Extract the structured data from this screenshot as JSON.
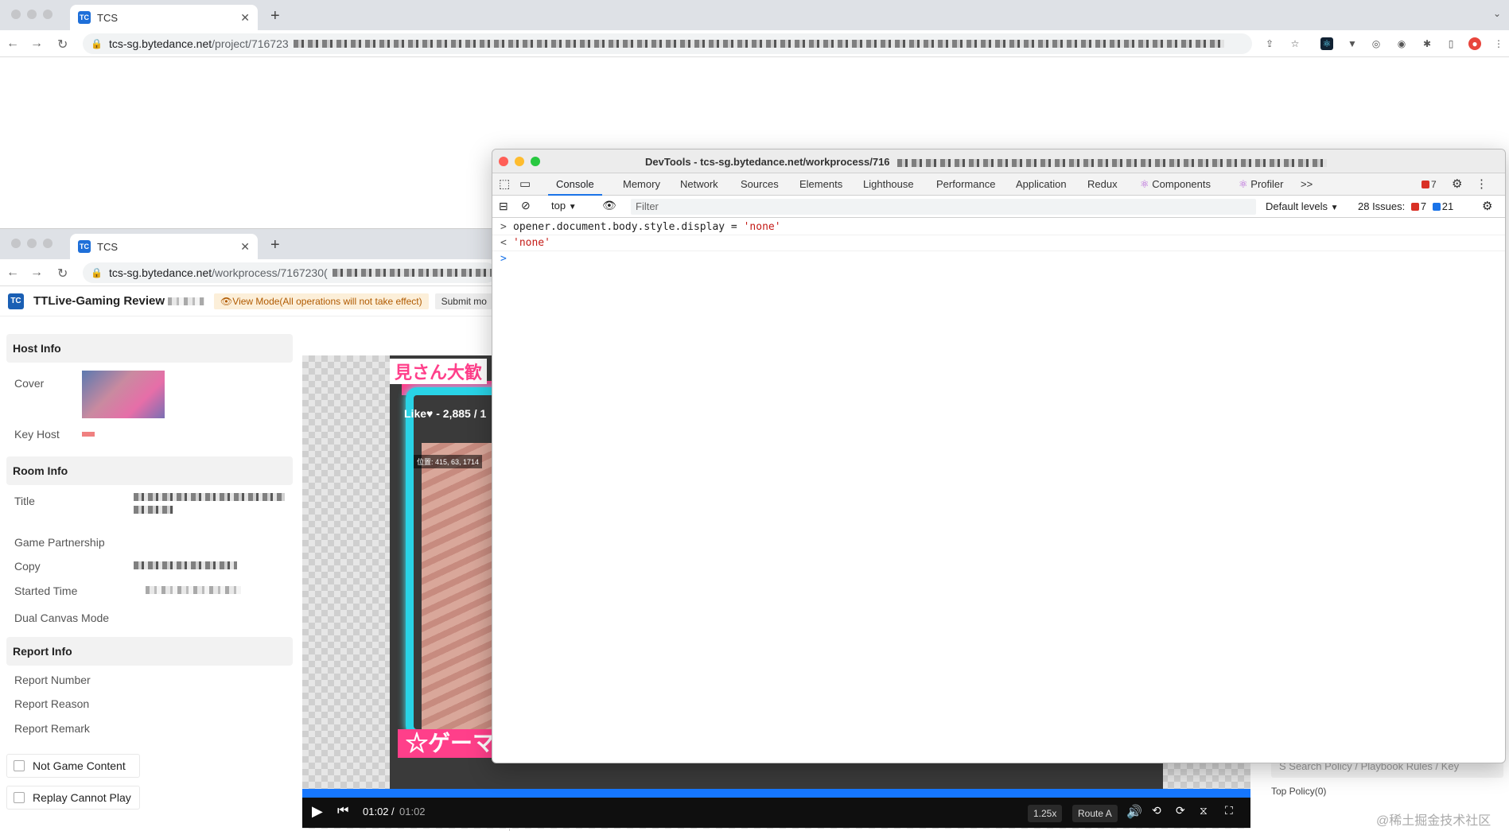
{
  "back_browser": {
    "tab_title": "TCS",
    "new_tab_icon": "+",
    "url_host": "tcs-sg.bytedance.net",
    "url_path": "/project/716723"
  },
  "front_browser": {
    "tab_title": "TCS",
    "new_tab_icon": "+",
    "url_host": "tcs-sg.bytedance.net",
    "url_path": "/workprocess/7167230("
  },
  "app": {
    "title": "TTLive-Gaming Review",
    "view_mode_badge": "View Mode(All operations will not take effect)",
    "submit_label": "Submit mo",
    "logo_text": "TC"
  },
  "left_panel": {
    "host_info": {
      "heading": "Host Info",
      "cover_label": "Cover",
      "key_host_label": "Key Host"
    },
    "room_info": {
      "heading": "Room Info",
      "title_label": "Title",
      "game_partnership_label": "Game Partnership",
      "copy_label": "Copy",
      "started_time_label": "Started Time",
      "dual_canvas_label": "Dual Canvas Mode"
    },
    "report_info": {
      "heading": "Report Info",
      "report_number_label": "Report Number",
      "report_reason_label": "Report Reason",
      "report_remark_label": "Report Remark"
    },
    "checkboxes": {
      "not_game_content": "Not Game Content",
      "replay_cannot_play": "Replay Cannot Play"
    }
  },
  "video": {
    "top_text": "見さん大歓",
    "like_text": "Like♥ - 2,885 / 1",
    "position_label": "位置: 415, 63, 1714",
    "bottom_text": "☆ゲーマ",
    "current_time": "01:02",
    "time_separator": "/",
    "duration": "01:02",
    "speed": "1.25x",
    "route": "Route A",
    "progress_fraction": 1.0
  },
  "right_panel": {
    "search_placeholder": "S   Search Policy / Playbook Rules / Key",
    "top_policy": "Top Policy(0)"
  },
  "watermark": "@稀土掘金技术社区",
  "devtools": {
    "title": "DevTools - tcs-sg.bytedance.net/workprocess/716",
    "tabs": {
      "console": "Console",
      "memory": "Memory",
      "network": "Network",
      "sources": "Sources",
      "elements": "Elements",
      "lighthouse": "Lighthouse",
      "performance": "Performance",
      "application": "Application",
      "redux": "Redux",
      "components": "Components",
      "profiler": "Profiler",
      "more": ">>"
    },
    "error_count": "7",
    "context": "top",
    "filter_placeholder": "Filter",
    "levels": "Default levels",
    "issues_label": "28 Issues:",
    "issues_errors": "7",
    "issues_info": "21",
    "console_input": "opener.document.body.style.display = ",
    "console_input_str": "'none'",
    "console_output": "'none'",
    "input_prompt": ">",
    "output_prompt": "<",
    "active_prompt": ">",
    "colors": {
      "error_red": "#d93025",
      "info_blue": "#1a73e8",
      "string_red": "#c41a16"
    }
  }
}
